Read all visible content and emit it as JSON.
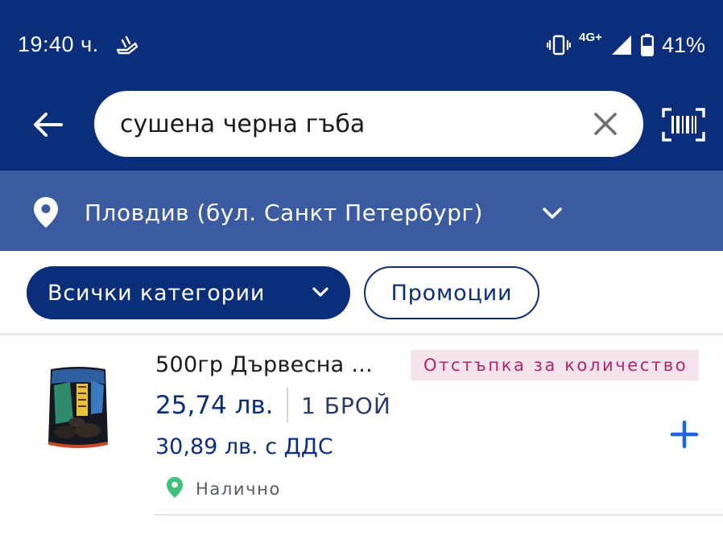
{
  "status_bar": {
    "time": "19:40 ч.",
    "network": "4G+",
    "battery": "41%",
    "icons": [
      "running-app-icon",
      "vibrate-icon",
      "signal-icon",
      "battery-icon"
    ]
  },
  "header": {
    "back_icon": "arrow-left-icon",
    "search": {
      "value": "сушена черна гъба",
      "clear_icon": "close-icon"
    },
    "scan_icon": "barcode-scan-icon"
  },
  "location": {
    "icon": "map-pin-icon",
    "label": "Пловдив (бул. Санкт Петербург)",
    "chevron_icon": "chevron-down-icon"
  },
  "filters": {
    "categories_label": "Всички категории",
    "promotions_label": "Промоции"
  },
  "products": [
    {
      "name": "500гр Дървесна ...",
      "badge": "Отстъпка за количество",
      "price": "25,74 лв.",
      "unit": "1 БРОЙ",
      "price_with_vat": "30,89 лв. с ДДС",
      "availability": "Налично",
      "add_icon": "plus-icon"
    }
  ],
  "colors": {
    "primary": "#0a2e7a",
    "location_bar": "#3b5ba0",
    "badge_bg": "#f5e3ec",
    "badge_text": "#b0246a",
    "available": "#3cc27a",
    "add": "#1a66e0"
  }
}
